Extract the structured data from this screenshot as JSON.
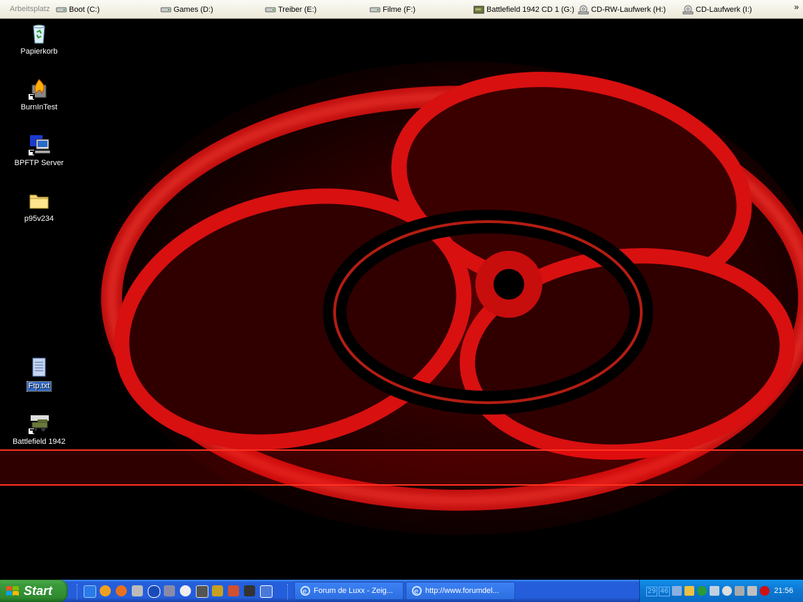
{
  "toolbar": {
    "label": "Arbeitsplatz",
    "drives": [
      {
        "label": "Boot (C:)",
        "icon": "hard-drive-icon"
      },
      {
        "label": "Games (D:)",
        "icon": "hard-drive-icon"
      },
      {
        "label": "Treiber (E:)",
        "icon": "hard-drive-icon"
      },
      {
        "label": "Filme (F:)",
        "icon": "hard-drive-icon"
      },
      {
        "label": "Battlefield 1942 CD 1 (G:)",
        "icon": "game-cd-icon"
      },
      {
        "label": "CD-RW-Laufwerk (H:)",
        "icon": "cd-drive-icon"
      },
      {
        "label": "CD-Laufwerk (I:)",
        "icon": "cd-drive-icon"
      }
    ],
    "more": "»"
  },
  "desktop": {
    "icons": [
      {
        "label": "Papierkorb",
        "icon": "recycle-bin-icon"
      },
      {
        "label": "BurnInTest",
        "icon": "burnintest-icon"
      },
      {
        "label": "BPFTP Server",
        "icon": "ftp-server-icon"
      },
      {
        "label": "p95v234",
        "icon": "folder-icon"
      },
      {
        "label": "Ftp.txt",
        "icon": "text-file-icon",
        "selected": true
      },
      {
        "label": "Battlefield 1942",
        "icon": "battlefield-icon"
      }
    ]
  },
  "taskbar": {
    "start_label": "Start",
    "tasks": [
      {
        "label": "Forum de Luxx - Zeig...",
        "icon": "internet-explorer-icon"
      },
      {
        "label": "http://www.forumdel...",
        "icon": "internet-explorer-icon"
      }
    ],
    "tray": {
      "cpu_1": "29",
      "cpu_2": "46",
      "clock": "21:56"
    }
  },
  "colors": {
    "taskbar": "#245edb",
    "start": "#3c9b3c",
    "tray": "#0c7ad6",
    "wallpaper_red": "#ff1a1a"
  }
}
